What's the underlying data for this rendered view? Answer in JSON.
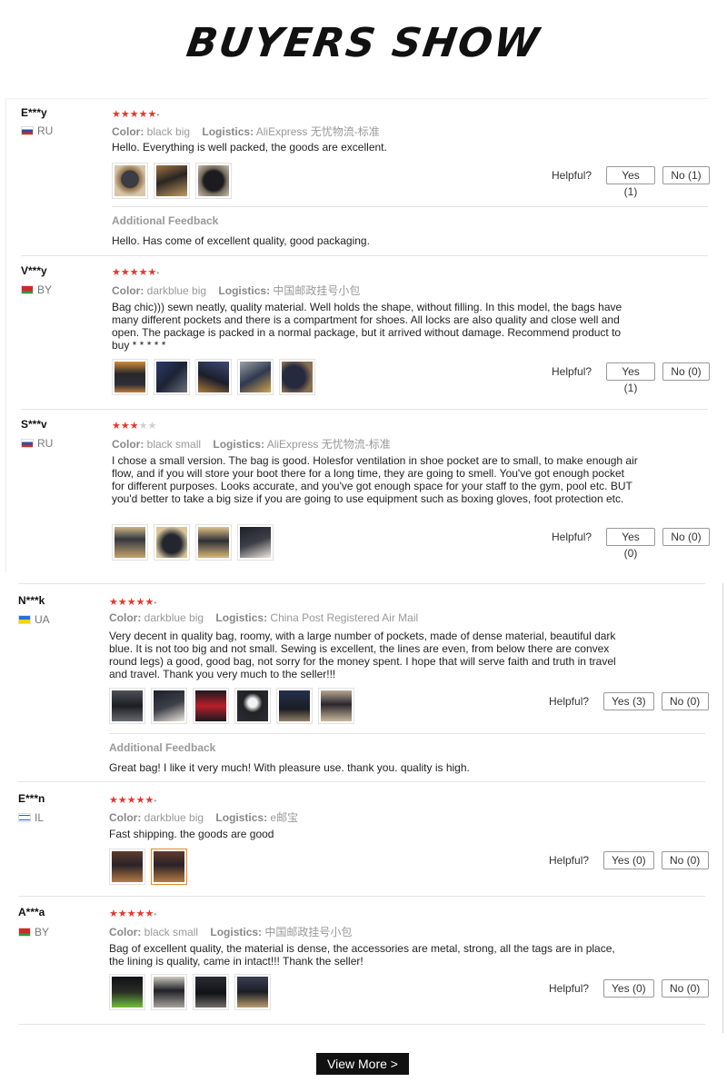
{
  "banner": {
    "title": "BUYERS SHOW"
  },
  "labels": {
    "color": "Color:",
    "logistics": "Logistics:",
    "helpful": "Helpful?",
    "additional_feedback": "Additional Feedback"
  },
  "reviews": [
    {
      "user": "E***y",
      "country": "RU",
      "rating": 5,
      "color": "black big",
      "logistics": "AliExpress 无忧物流-标准",
      "text": "Hello. Everything is well packed, the goods are excellent.",
      "images": 3,
      "yes": "Yes (1)",
      "no": "No (1)",
      "additional": "Hello. Has come of excellent quality, good packaging."
    },
    {
      "user": "V***y",
      "country": "BY",
      "rating": 5,
      "color": "darkblue big",
      "logistics": "中国邮政挂号小包",
      "text": "Bag chic))) sewn neatly, quality material. Well holds the shape, without filling. In this model, the bags have many different pockets and there is a compartment for shoes. All locks are also quality and close well and open. The package is packed in a normal package, but it arrived without damage. Recommend product to buy * * * * *",
      "images": 5,
      "yes": "Yes (1)",
      "no": "No (0)"
    },
    {
      "user": "S***v",
      "country": "RU",
      "rating": 3,
      "color": "black small",
      "logistics": "AliExpress 无忧物流-标准",
      "text": "I chose a small version. The bag is good. Holesfor ventilation in shoe pocket are to small, to make enough air flow, and if you will store your boot there for a long time, they are going to smell. You've got enough pocket for different purposes. Looks accurate, and you've got enough space for your staff to the gym, pool etc. BUT you'd better to take a big size if you are going to use equipment such as boxing gloves, foot protection etc.",
      "images": 4,
      "yes": "Yes (0)",
      "no": "No (0)"
    },
    {
      "user": "N***k",
      "country": "UA",
      "rating": 5,
      "color": "darkblue big",
      "logistics": "China Post Registered Air Mail",
      "text": "Very decent in quality bag, roomy, with a large number of pockets, made of dense material, beautiful dark blue. It is not too big and not small. Sewing is excellent, the lines are even, from below there are convex round legs) a good, good bag, not sorry for the money spent. I hope that will serve faith and truth in travel and travel. Thank you very much to the seller!!!",
      "images": 6,
      "yes": "Yes (3)",
      "no": "No (0)",
      "additional": "Great bag! I like it very much! With pleasure use. thank you. quality is high."
    },
    {
      "user": "E***n",
      "country": "IL",
      "rating": 5,
      "color": "darkblue big",
      "logistics": "e邮宝",
      "text": "Fast shipping. the goods are good",
      "images": 2,
      "yes": "Yes (0)",
      "no": "No (0)"
    },
    {
      "user": "A***a",
      "country": "BY",
      "rating": 5,
      "color": "black small",
      "logistics": "中国邮政挂号小包",
      "text": "Bag of excellent quality, the material is dense, the accessories are metal, strong, all the tags are in place, the lining is quality, came in intact!!! Thank the seller!",
      "images": 4,
      "yes": "Yes (0)",
      "no": "No (0)"
    }
  ],
  "view_more": "View More >",
  "colors": {
    "star": "#e8352d",
    "button": "#111111",
    "accent_border": "#e08a2b"
  }
}
